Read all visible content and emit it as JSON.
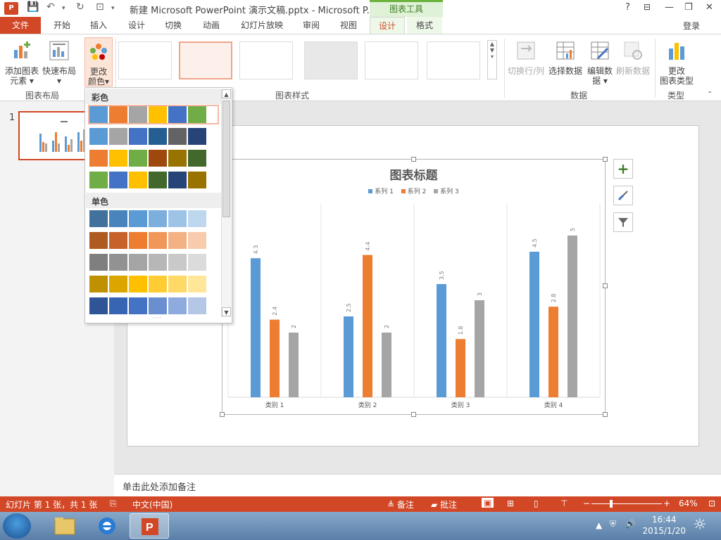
{
  "titlebar": {
    "app_logo": "P",
    "title": "新建 Microsoft PowerPoint 演示文稿.pptx - Microsoft P...",
    "context_tools": "图表工具",
    "help": "?",
    "min": "—",
    "restore": "❐",
    "close": "✕"
  },
  "tabs": {
    "file": "文件",
    "items": [
      "开始",
      "插入",
      "设计",
      "切换",
      "动画",
      "幻灯片放映",
      "审阅",
      "视图",
      "设计",
      "格式"
    ],
    "login": "登录"
  },
  "ribbon": {
    "add_element_1": "添加图表",
    "add_element_2": "元素",
    "quick_layout": "快速布局",
    "change_colors_1": "更改",
    "change_colors_2": "颜色",
    "group_layout": "图表布局",
    "group_styles": "图表样式",
    "switch_rowcol": "切换行/列",
    "select_data": "选择数据",
    "edit_data_1": "编辑数",
    "edit_data_2": "据",
    "refresh_data": "刷新数据",
    "group_data": "数据",
    "change_type_1": "更改",
    "change_type_2": "图表类型",
    "group_type": "类型"
  },
  "color_dropdown": {
    "colorful_header": "彩色",
    "mono_header": "单色",
    "colorful_rows": [
      [
        "#5b9bd5",
        "#ed7d31",
        "#a5a5a5",
        "#ffc000",
        "#4472c4",
        "#70ad47"
      ],
      [
        "#5b9bd5",
        "#a5a5a5",
        "#4472c4",
        "#255e91",
        "#636363",
        "#264478"
      ],
      [
        "#ed7d31",
        "#ffc000",
        "#70ad47",
        "#9e480e",
        "#997300",
        "#43682b"
      ],
      [
        "#70ad47",
        "#4472c4",
        "#ffc000",
        "#43682b",
        "#264478",
        "#997300"
      ]
    ],
    "mono_rows": [
      [
        "#41719c",
        "#4a84bd",
        "#5b9bd5",
        "#7cafdd",
        "#9dc3e6",
        "#bdd7ee"
      ],
      [
        "#ae5a21",
        "#c8622b",
        "#ed7d31",
        "#f1975a",
        "#f4b183",
        "#f8cbad"
      ],
      [
        "#7f7f7f",
        "#929292",
        "#a5a5a5",
        "#b7b7b7",
        "#c9c9c9",
        "#dbdbdb"
      ],
      [
        "#bf9000",
        "#dba600",
        "#ffc000",
        "#ffcd33",
        "#ffd966",
        "#ffe699"
      ],
      [
        "#2f5597",
        "#3864b4",
        "#4472c4",
        "#6a8fd0",
        "#8faadc",
        "#b4c7e7"
      ]
    ]
  },
  "slide_panel": {
    "number": "1"
  },
  "chart_data": {
    "type": "bar",
    "title": "图表标题",
    "categories": [
      "类别 1",
      "类别 2",
      "类别 3",
      "类别 4"
    ],
    "series": [
      {
        "name": "系列 1",
        "color": "#5b9bd5",
        "values": [
          4.3,
          2.5,
          3.5,
          4.5
        ],
        "labels": [
          "4.3",
          "2.5",
          "3.5",
          "4.5"
        ]
      },
      {
        "name": "系列 2",
        "color": "#ed7d31",
        "values": [
          2.4,
          4.4,
          1.8,
          2.8
        ],
        "labels": [
          "2.4",
          "4.4",
          "1.8",
          "2.8"
        ]
      },
      {
        "name": "系列 3",
        "color": "#a5a5a5",
        "values": [
          2,
          2,
          3,
          5
        ],
        "labels": [
          "2",
          "2",
          "3",
          "5"
        ]
      }
    ],
    "ylim": [
      0,
      6
    ],
    "legend": "top",
    "grid": "vertical category separators"
  },
  "notes": {
    "placeholder": "单击此处添加备注"
  },
  "status": {
    "slide_info": "幻灯片 第 1 张，共 1 张",
    "language": "中文(中国)",
    "notes_btn": "备注",
    "comments_btn": "批注",
    "zoom": "64%"
  },
  "taskbar": {
    "time": "16:44",
    "date": "2015/1/20"
  }
}
